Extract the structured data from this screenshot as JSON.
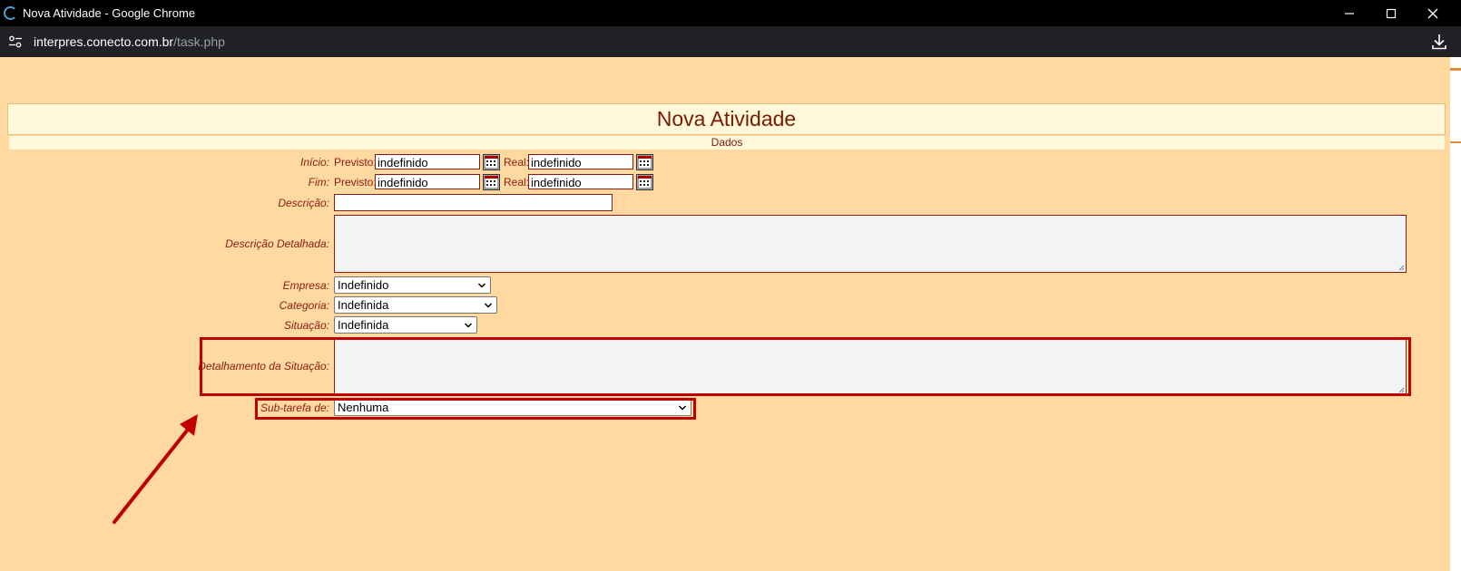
{
  "window": {
    "title": "Nova Atividade - Google Chrome",
    "url_host": "interpres.conecto.com.br",
    "url_path": "/task.php"
  },
  "page": {
    "heading": "Nova Atividade",
    "section": "Dados"
  },
  "form": {
    "inicio": {
      "label": "Início:",
      "previsto_label": "Previsto:",
      "previsto_value": "indefinido",
      "real_label": "Real:",
      "real_value": "indefinido"
    },
    "fim": {
      "label": "Fim:",
      "previsto_label": "Previsto:",
      "previsto_value": "indefinido",
      "real_label": "Real:",
      "real_value": "indefinido"
    },
    "descricao": {
      "label": "Descrição:",
      "value": ""
    },
    "descricao_detalhada": {
      "label": "Descrição Detalhada:",
      "value": ""
    },
    "empresa": {
      "label": "Empresa:",
      "selected": "Indefinido"
    },
    "categoria": {
      "label": "Categoria:",
      "selected": "Indefinida"
    },
    "situacao": {
      "label": "Situação:",
      "selected": "Indefinida"
    },
    "detalhamento_situacao": {
      "label": "Detalhamento da Situação:",
      "value": ""
    },
    "sub_tarefa": {
      "label": "Sub-tarefa de:",
      "selected": "Nenhuma"
    }
  },
  "colors": {
    "page_background": "#ffd9a0",
    "label_color": "#8b1a10",
    "highlight_color": "#c00000"
  }
}
